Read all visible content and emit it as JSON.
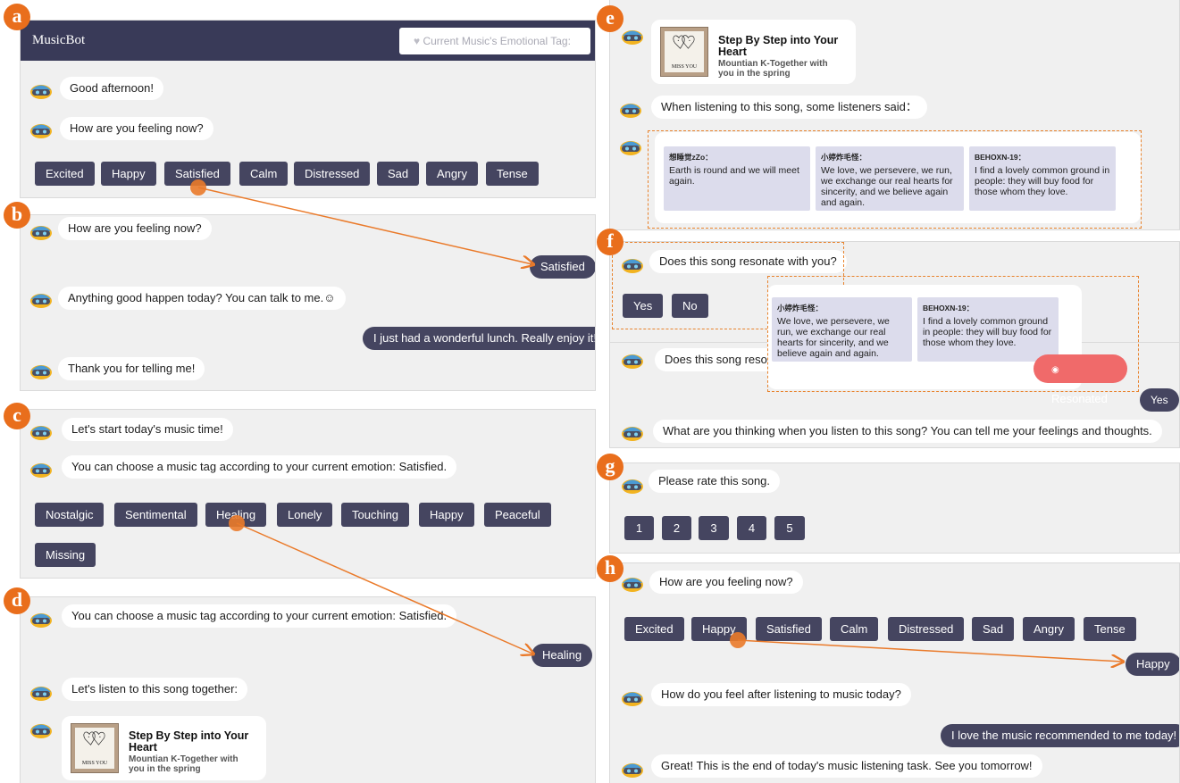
{
  "panel_labels": [
    "a",
    "b",
    "c",
    "d",
    "e",
    "f",
    "g",
    "h"
  ],
  "a": {
    "app_title": "MusicBot",
    "emotion_tag_button": "Current Music's Emotional Tag:",
    "msg1": "Good afternoon!",
    "msg2": "How are you feeling now?",
    "emotions": [
      "Excited",
      "Happy",
      "Satisfied",
      "Calm",
      "Distressed",
      "Sad",
      "Angry",
      "Tense"
    ]
  },
  "b": {
    "msg1": "How are you feeling now?",
    "user1": "Satisfied",
    "msg2": "Anything good happen today? You can talk to me.☺",
    "user2": "I just had a wonderful lunch. Really enjoy it!",
    "msg3": "Thank you for telling me!"
  },
  "c": {
    "msg1": "Let's start today's music time!",
    "msg2": "You can choose a music tag according to your current emotion: Satisfied.",
    "tags": [
      "Nostalgic",
      "Sentimental",
      "Healing",
      "Lonely",
      "Touching",
      "Happy",
      "Peaceful",
      "Missing"
    ]
  },
  "d": {
    "msg1": "You can choose a music tag according to your current emotion: Satisfied.",
    "user1": "Healing",
    "msg2": "Let's listen to this song together:"
  },
  "song": {
    "title_line1": "Step By Step into Your",
    "title_line2": "Heart",
    "artist_line1": "Mountian K-Together with",
    "artist_line2": "you in the spring",
    "cover_text": "MISS YOU"
  },
  "e": {
    "msg1": "When listening to this song, some listeners said：",
    "comments": [
      {
        "user": "想睡觉zZo：",
        "text": "Earth is round and we will meet again."
      },
      {
        "user": "小婷炸毛怪：",
        "text": "We love, we persevere, we run, we exchange our real hearts for sincerity, and we believe again and again."
      },
      {
        "user": "BEHOXN-19：",
        "text": "I find a lovely common ground in people: they will buy food for those whom they love."
      }
    ]
  },
  "f": {
    "msg1": "Does this song resonate with you?",
    "yes": "Yes",
    "no": "No",
    "msg2_partial": "Does this song resona",
    "resonated": "Resonated",
    "user1": "Yes",
    "msg3": "What are you thinking when you listen to this song? You can tell me your feelings and thoughts."
  },
  "g": {
    "msg1": "Please rate this song.",
    "ratings": [
      "1",
      "2",
      "3",
      "4",
      "5"
    ]
  },
  "h": {
    "msg1": "How are you feeling now?",
    "emotions": [
      "Excited",
      "Happy",
      "Satisfied",
      "Calm",
      "Distressed",
      "Sad",
      "Angry",
      "Tense"
    ],
    "user1": "Happy",
    "msg2": "How do you feel after listening to music today?",
    "user2": "I love the music recommended to me today!",
    "msg3": "Great! This is the end of today's music listening task. See you tomorrow!"
  },
  "colors": {
    "accent": "#e96e1c",
    "button": "#454560",
    "header": "#393a58",
    "resonated": "#f06a6a"
  }
}
